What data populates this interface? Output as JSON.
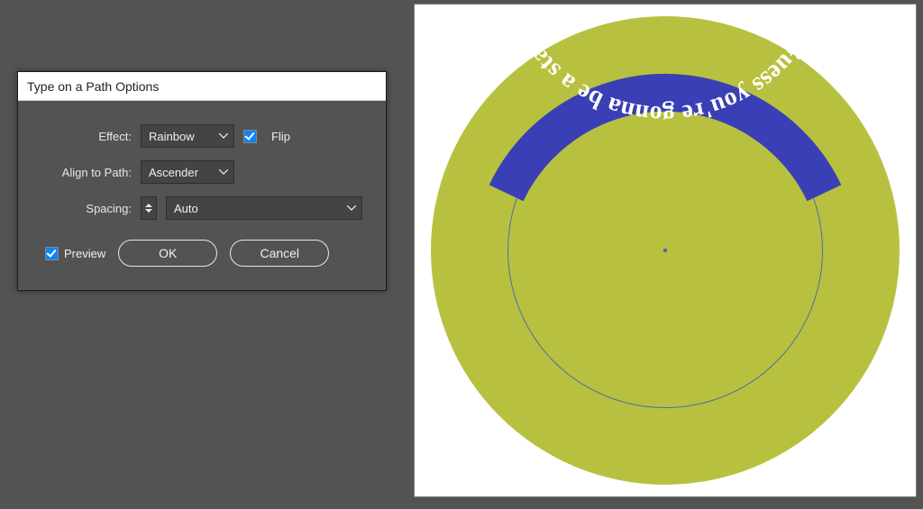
{
  "dialog": {
    "title": "Type on a Path Options",
    "effect_label": "Effect:",
    "effect_value": "Rainbow",
    "flip_label": "Flip",
    "flip_checked": true,
    "align_label": "Align to Path:",
    "align_value": "Ascender",
    "spacing_label": "Spacing:",
    "spacing_value": "Auto",
    "preview_label": "Preview",
    "preview_checked": true,
    "ok_label": "OK",
    "cancel_label": "Cancel"
  },
  "artwork": {
    "bg_color": "#b7c13f",
    "band_color": "#3a3fb5",
    "text": "Guess you're gonna be a star",
    "text_color": "#ffffff"
  }
}
